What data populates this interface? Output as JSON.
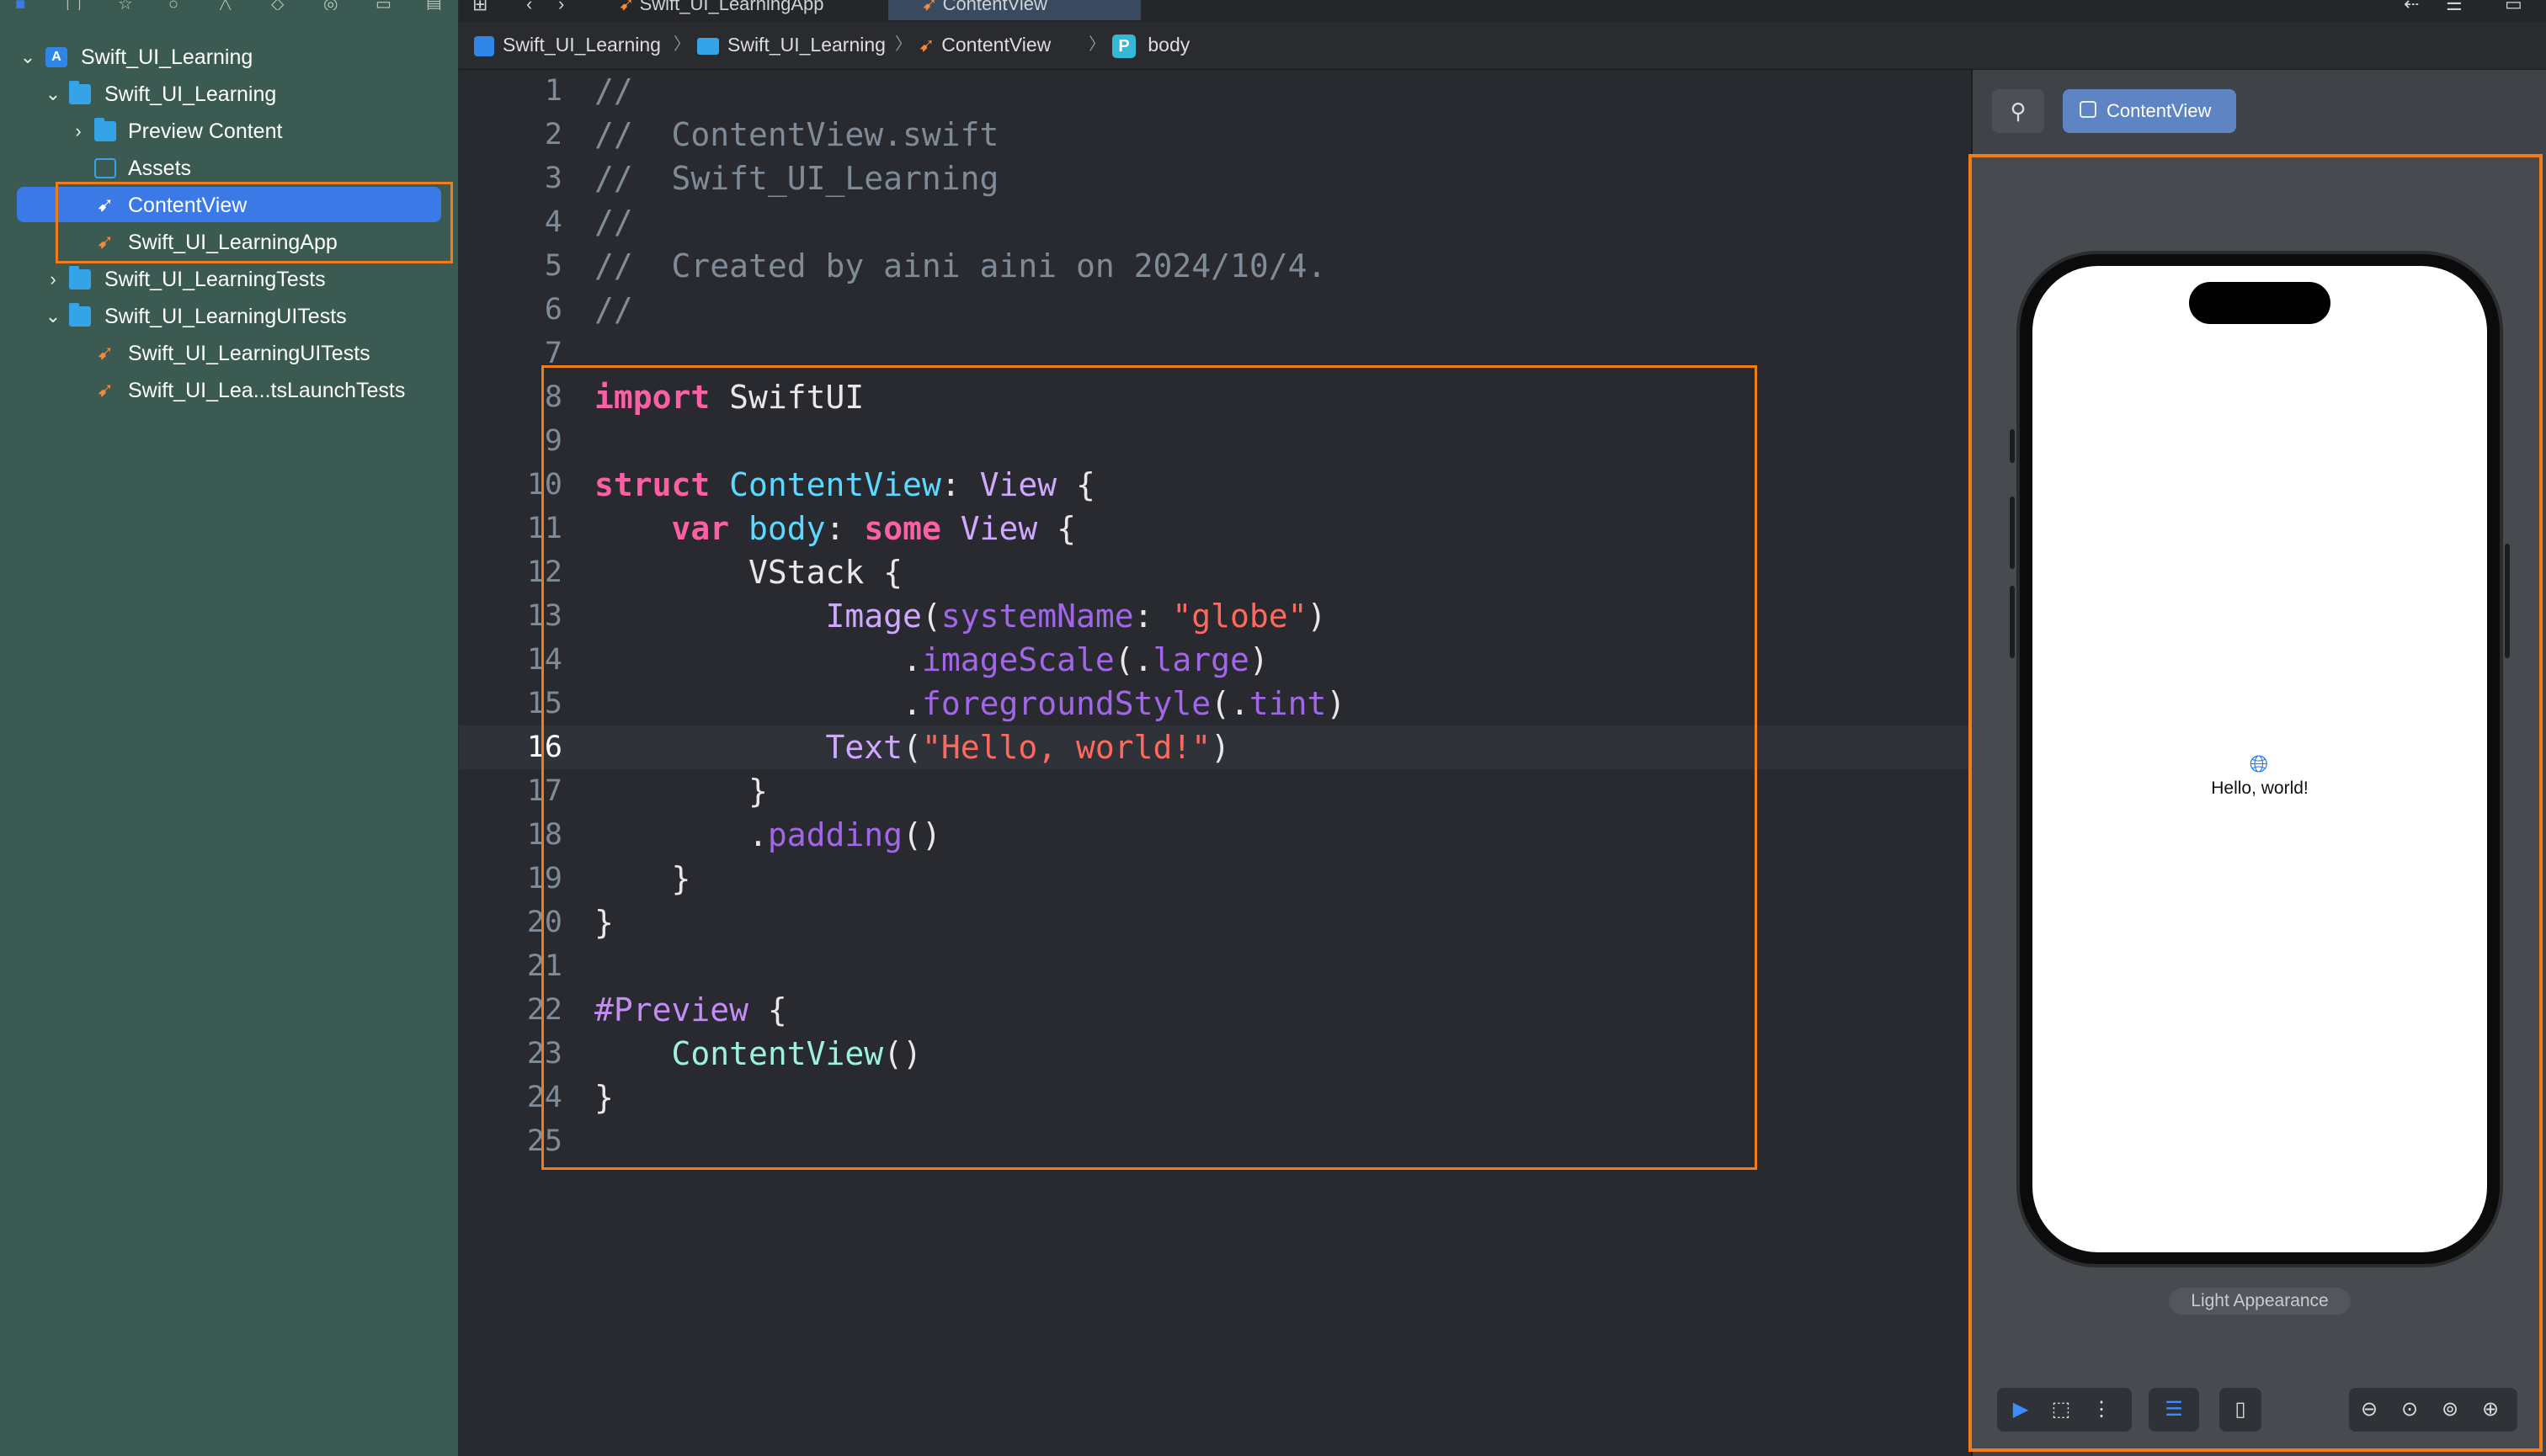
{
  "navigator": {
    "root": "Swift_UI_Learning",
    "items": [
      {
        "label": "Swift_UI_Learning"
      },
      {
        "label": "Preview Content"
      },
      {
        "label": "Assets"
      },
      {
        "label": "ContentView"
      },
      {
        "label": "Swift_UI_LearningApp"
      },
      {
        "label": "Swift_UI_LearningTests"
      },
      {
        "label": "Swift_UI_LearningUITests"
      },
      {
        "label": "Swift_UI_LearningUITests"
      },
      {
        "label": "Swift_UI_Lea...tsLaunchTests"
      }
    ]
  },
  "tabs": [
    {
      "label": "Swift_UI_LearningApp"
    },
    {
      "label": "ContentView"
    }
  ],
  "breadcrumb": {
    "project": "Swift_UI_Learning",
    "folder": "Swift_UI_Learning",
    "file": "ContentView",
    "symbol_badge": "P",
    "symbol": "body"
  },
  "editor": {
    "current_line": 16,
    "line_numbers": [
      "1",
      "2",
      "3",
      "4",
      "5",
      "6",
      "7",
      "8",
      "9",
      "10",
      "11",
      "12",
      "13",
      "14",
      "15",
      "16",
      "17",
      "18",
      "19",
      "20",
      "21",
      "22",
      "23",
      "24",
      "25"
    ],
    "code": {
      "l1": "//",
      "l2": "//  ContentView.swift",
      "l3": "//  Swift_UI_Learning",
      "l4": "//",
      "l5": "//  Created by aini aini on 2024/10/4.",
      "l6": "//",
      "l8_kw": "import",
      "l8_rest": " SwiftUI",
      "l10_kw": "struct",
      "l10_name": " ContentView",
      "l10_colon": ": ",
      "l10_type": "View",
      "l10_brace": " {",
      "l11_indent": "    ",
      "l11_kw": "var",
      "l11_body": " body",
      "l11_colon": ": ",
      "l11_kw2": "some",
      "l11_type": " View",
      "l11_brace": " {",
      "l12": "        VStack {",
      "l13_indent": "            ",
      "l13_fn": "Image",
      "l13_p1": "(",
      "l13_arg": "systemName",
      "l13_p2": ": ",
      "l13_str": "\"globe\"",
      "l13_p3": ")",
      "l14_indent": "                .",
      "l14_fn": "imageScale",
      "l14_p1": "(.",
      "l14_arg": "large",
      "l14_p2": ")",
      "l15_indent": "                .",
      "l15_fn": "foregroundStyle",
      "l15_p1": "(.",
      "l15_arg": "tint",
      "l15_p2": ")",
      "l16_indent": "            ",
      "l16_fn": "Text",
      "l16_p1": "(",
      "l16_str": "\"Hello, world!\"",
      "l16_p2": ")",
      "l17": "        }",
      "l18_indent": "        .",
      "l18_fn": "padding",
      "l18_p": "()",
      "l19": "    }",
      "l20": "}",
      "l22_mac": "#Preview",
      "l22_brace": " {",
      "l23_indent": "    ",
      "l23_fn": "ContentView",
      "l23_p": "()",
      "l24": "}"
    }
  },
  "canvas": {
    "preview_button": "ContentView",
    "device_text": "Hello, world!",
    "appearance_label": "Light Appearance",
    "icons": [
      "pin-icon",
      "live-preview-icon",
      "selectable-icon",
      "variants-icon",
      "canvas-settings-icon",
      "device-icon",
      "zoom-out-icon",
      "zoom-100-icon",
      "zoom-fit-icon",
      "zoom-in-icon"
    ]
  },
  "colors": {
    "accent_orange": "#f07d1a",
    "selection_blue": "#3b7ae6",
    "navigator_bg": "#3b5a52",
    "editor_bg": "#292a30"
  }
}
